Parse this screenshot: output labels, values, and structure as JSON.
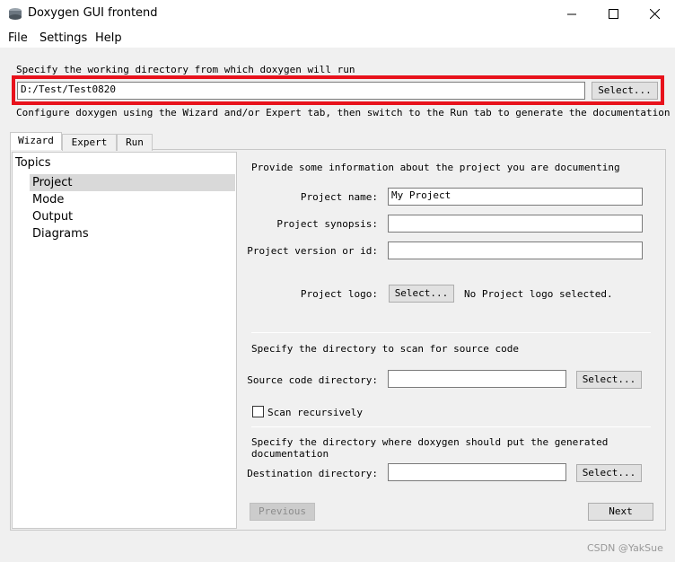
{
  "window": {
    "title": "Doxygen GUI frontend",
    "icons": {
      "app": "doxygen-app-icon",
      "minimize": "minimize-icon",
      "maximize": "maximize-icon",
      "close": "close-icon"
    }
  },
  "menu": {
    "file": "File",
    "settings": "Settings",
    "help": "Help"
  },
  "workdir": {
    "label": "Specify the working directory from which doxygen will run",
    "value": "D:/Test/Test0820",
    "select_label": "Select...",
    "highlight_color": "#e8121c"
  },
  "configure_hint": "Configure doxygen using the Wizard and/or Expert tab, then switch to the Run tab to generate the documentation",
  "tabs": [
    {
      "label": "Wizard",
      "active": true
    },
    {
      "label": "Expert",
      "active": false
    },
    {
      "label": "Run",
      "active": false
    }
  ],
  "topics": {
    "header": "Topics",
    "items": [
      {
        "label": "Project",
        "selected": true
      },
      {
        "label": "Mode",
        "selected": false
      },
      {
        "label": "Output",
        "selected": false
      },
      {
        "label": "Diagrams",
        "selected": false
      }
    ]
  },
  "project": {
    "intro": "Provide some information about the project you are documenting",
    "name_label": "Project name:",
    "name_value": "My Project",
    "synopsis_label": "Project synopsis:",
    "synopsis_value": "",
    "version_label": "Project version or id:",
    "version_value": "",
    "logo_label": "Project logo:",
    "logo_select": "Select...",
    "logo_status": "No Project logo selected."
  },
  "source": {
    "intro": "Specify the directory to scan for source code",
    "dir_label": "Source code directory:",
    "dir_value": "",
    "select_label": "Select...",
    "recursive_label": "Scan recursively",
    "recursive_checked": false
  },
  "destination": {
    "intro": "Specify the directory where doxygen should put the generated documentation",
    "dir_label": "Destination directory:",
    "dir_value": "",
    "select_label": "Select..."
  },
  "nav": {
    "previous": "Previous",
    "next": "Next"
  },
  "watermark": "CSDN @YakSue"
}
